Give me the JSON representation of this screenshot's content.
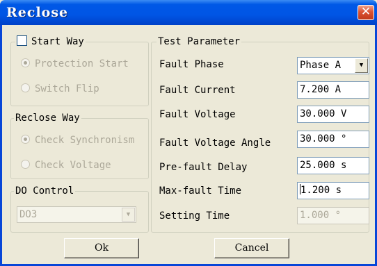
{
  "window": {
    "title": "Reclose"
  },
  "start_way": {
    "legend": "Start Way",
    "checked": false,
    "options": [
      {
        "label": "Protection Start",
        "selected": true
      },
      {
        "label": "Switch Flip",
        "selected": false
      }
    ]
  },
  "reclose_way": {
    "legend": "Reclose Way",
    "options": [
      {
        "label": "Check Synchronism",
        "selected": true
      },
      {
        "label": "Check Voltage",
        "selected": false
      }
    ]
  },
  "do_control": {
    "legend": "DO Control",
    "value": "DO3"
  },
  "test_parameter": {
    "legend": "Test Parameter",
    "rows": [
      {
        "label": "Fault Phase",
        "value": "Phase A"
      },
      {
        "label": "Fault Current",
        "value": "7.200 A"
      },
      {
        "label": "Fault Voltage",
        "value": "30.000 V"
      },
      {
        "label": "Fault Voltage Angle",
        "value": "30.000 °"
      },
      {
        "label": "Pre-fault Delay",
        "value": "25.000 s"
      },
      {
        "label": "Max-fault Time",
        "value": "1.200 s"
      },
      {
        "label": "Setting Time",
        "value": "1.000 °"
      }
    ]
  },
  "buttons": {
    "ok": "Ok",
    "cancel": "Cancel"
  },
  "icons": {
    "close": "close-x-icon",
    "dropdown": "chevron-down-icon"
  },
  "colors": {
    "title_bar": "#0055E5",
    "dialog_bg": "#ECE9D8",
    "disabled_text": "#ACA899",
    "close_button": "#DB5334"
  }
}
